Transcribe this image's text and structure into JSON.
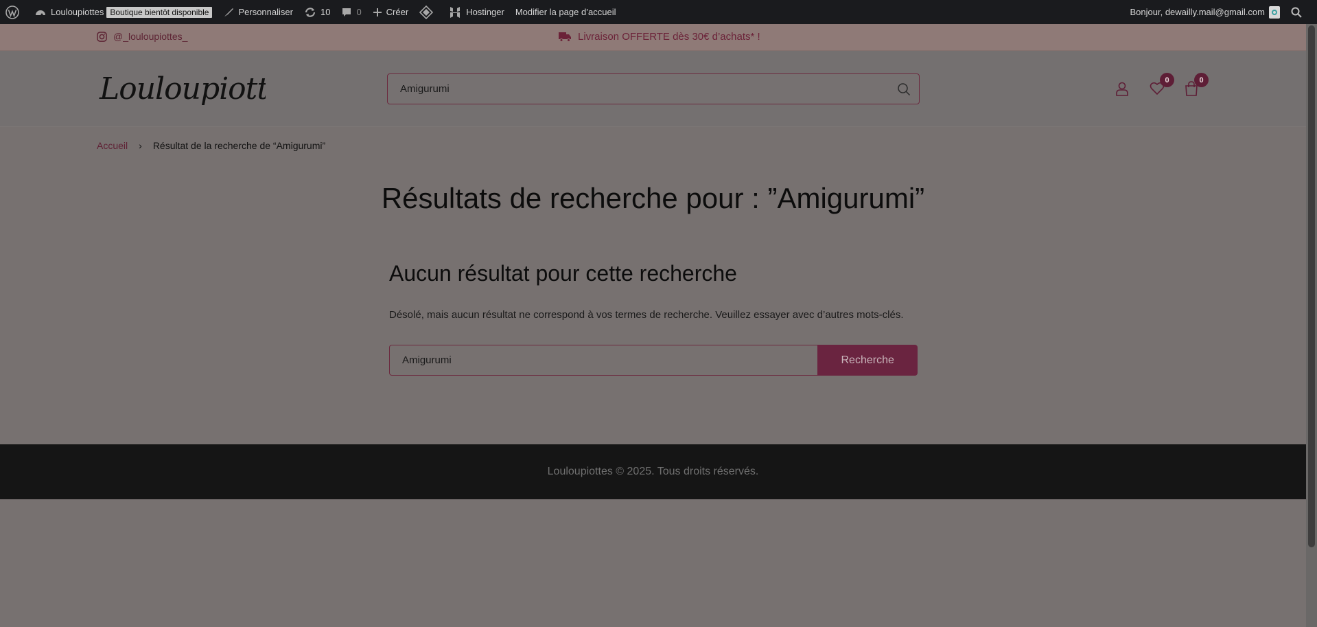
{
  "adminbar": {
    "site_name": "Louloupiottes",
    "status_badge": "Boutique bientôt disponible",
    "customize": "Personnaliser",
    "updates_count": "10",
    "comments_count": "0",
    "create": "Créer",
    "hostinger": "Hostinger",
    "edit_home": "Modifier la page d’accueil",
    "greeting": "Bonjour, dewailly.mail@gmail.com"
  },
  "topbar": {
    "instagram": "@_louloupiottes_",
    "promo": "Livraison OFFERTE dès 30€ d’achats* !"
  },
  "header": {
    "logo_text": "Louloupiottes",
    "search_value": "Amigurumi",
    "wishlist_count": "0",
    "cart_count": "0"
  },
  "breadcrumb": {
    "home": "Accueil",
    "separator": "›",
    "current": "Résultat de la recherche de “Amigurumi”"
  },
  "main": {
    "title": "Résultats de recherche pour : ”Amigurumi”",
    "no_results_title": "Aucun résultat pour cette recherche",
    "no_results_text": "Désolé, mais aucun résultat ne correspond à vos termes de recherche. Veuillez essayer avec d’autres mots-clés.",
    "search_value": "Amigurumi",
    "search_button": "Recherche"
  },
  "footer": {
    "copyright": "Louloupiottes © 2025. Tous droits réservés."
  },
  "colors": {
    "accent": "#6a2440",
    "adminbar": "#1a1b1e",
    "footer": "#151515",
    "topbar": "#8f7a77"
  }
}
